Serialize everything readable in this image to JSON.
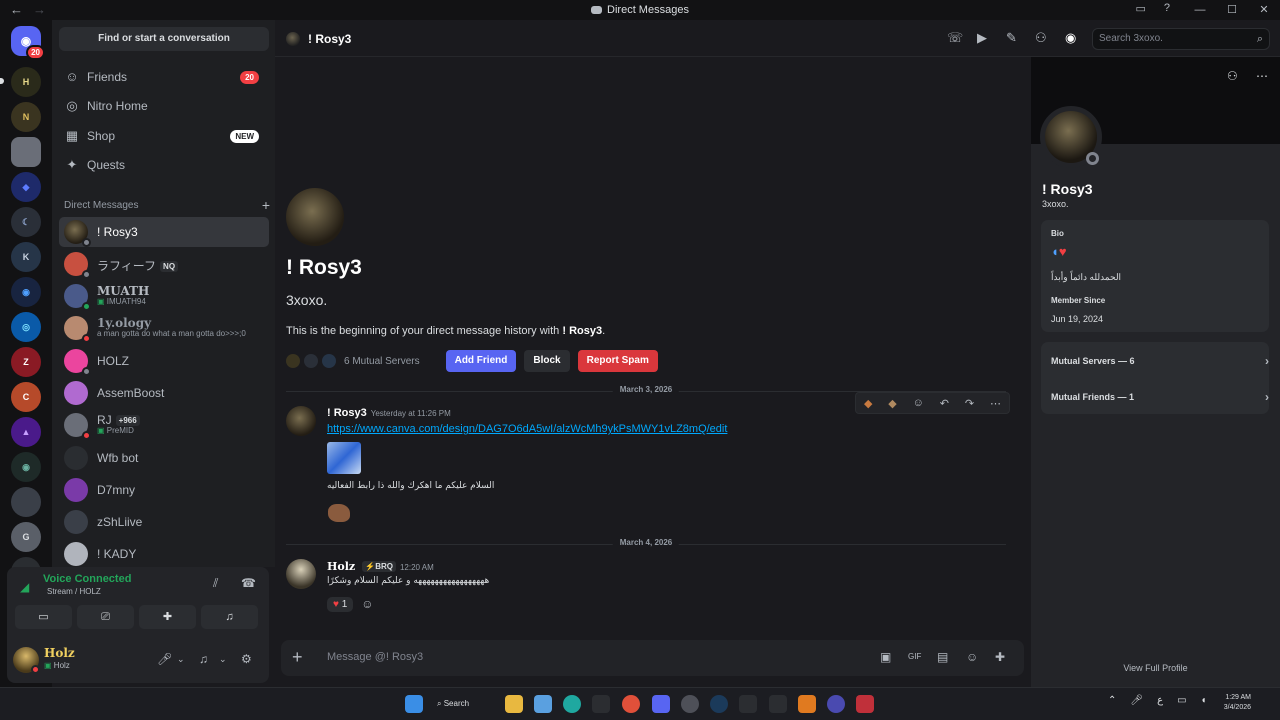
{
  "window": {
    "title": "Direct Messages"
  },
  "rail": {
    "home_badge": "20"
  },
  "sidebar": {
    "find_placeholder": "Find or start a conversation",
    "nav": [
      {
        "label": "Friends",
        "icon": "friends-icon",
        "badge": "20"
      },
      {
        "label": "Nitro Home",
        "icon": "nitro-icon"
      },
      {
        "label": "Shop",
        "icon": "shop-icon",
        "badge": "NEW"
      },
      {
        "label": "Quests",
        "icon": "quests-icon"
      }
    ],
    "dm_header": "Direct Messages",
    "dms": [
      {
        "name": "! Rosy3",
        "active": true
      },
      {
        "name": "ラフィーフ",
        "tag": "NQ"
      },
      {
        "name": "MUATH",
        "sub": "IMUATH94"
      },
      {
        "name": "1y.ology",
        "sub": "a man gotta do what a man gotta do>>>;0"
      },
      {
        "name": "HOLZ"
      },
      {
        "name": "AssemBoost"
      },
      {
        "name": "RJ",
        "tag": "+966",
        "sub": "PreMID"
      },
      {
        "name": "Wfb bot"
      },
      {
        "name": "D7mny"
      },
      {
        "name": "zShLiive"
      },
      {
        "name": "! KADY"
      }
    ]
  },
  "voice": {
    "status": "Voice Connected",
    "channel": "Stream / HOLZ"
  },
  "user": {
    "name": "Holz",
    "status": "Holz"
  },
  "chat_header": {
    "name": "! Rosy3",
    "search_placeholder": "Search 3xoxo."
  },
  "intro": {
    "name": "! Rosy3",
    "tag": "3xoxo.",
    "begin_text": "This is the beginning of your direct message history with",
    "begin_name": "! Rosy3",
    "begin_end": ".",
    "mutual_servers": "6 Mutual Servers",
    "add_friend": "Add Friend",
    "block": "Block",
    "report_spam": "Report Spam"
  },
  "messages": [
    {
      "date": "March 3, 2026",
      "author": "! Rosy3",
      "time": "Yesterday at 11:26 PM",
      "link": "https://www.canva.com/design/DAG7O6dA5wI/alzWcMh9ykPsMWY1vLZ8mQ/edit",
      "text": "السلام عليكم ما اهكرك والله ذا رابط الفعاليه"
    },
    {
      "date": "March 4, 2026",
      "author": "Holz",
      "author_tag": "BRQ",
      "time": "12:20 AM",
      "text": "هههههههههههههههههه و عليكم السلام وشكرًا",
      "reaction_count": "1"
    }
  ],
  "composer": {
    "placeholder": "Message @! Rosy3"
  },
  "profile": {
    "name": "! Rosy3",
    "tag": "3xoxo.",
    "bio_label": "Bio",
    "bio_text": "الحمدلله دائماً وأبداً",
    "member_since_label": "Member Since",
    "member_since": "Jun 19, 2024",
    "mutual_servers": "Mutual Servers — 6",
    "mutual_friends": "Mutual Friends — 1",
    "view_full": "View Full Profile"
  },
  "taskbar": {
    "search": "Search",
    "time": "1:29 AM",
    "date": "3/4/2026",
    "lang": "ع"
  },
  "colors": {
    "accent": "#5865f2",
    "danger": "#da373c",
    "online": "#23a55a"
  }
}
